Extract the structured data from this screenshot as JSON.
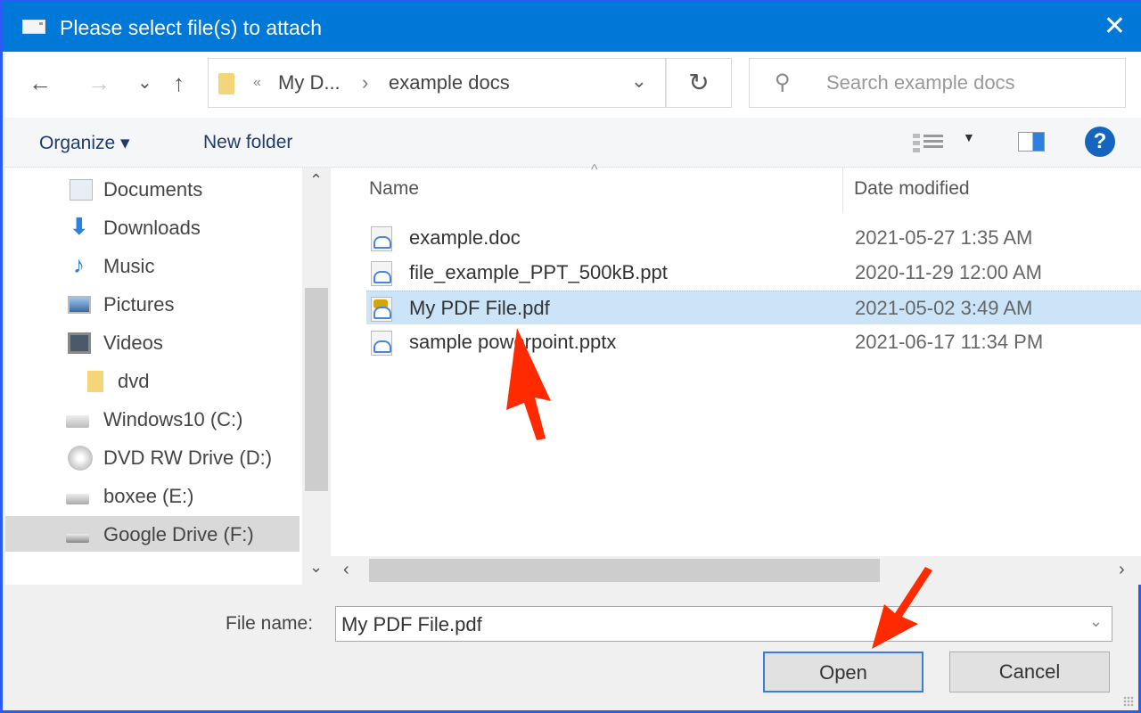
{
  "window": {
    "title": "Please select file(s) to attach",
    "close_icon": "close-icon"
  },
  "nav": {
    "back": "←",
    "forward": "→",
    "recent": "⌄",
    "up": "↑",
    "breadcrumb": [
      "«",
      "My D...",
      "›",
      "example docs"
    ],
    "address_dropdown": "⌄",
    "refresh": "↻",
    "search_placeholder": "Search example docs"
  },
  "toolbar": {
    "organize": "Organize ▾",
    "new_folder": "New folder",
    "views_dropdown": "▼",
    "help": "?"
  },
  "sidebar": {
    "items": [
      {
        "label": "Documents",
        "icon": "documents-icon"
      },
      {
        "label": "Downloads",
        "icon": "downloads-icon"
      },
      {
        "label": "Music",
        "icon": "music-icon"
      },
      {
        "label": "Pictures",
        "icon": "pictures-icon"
      },
      {
        "label": "Videos",
        "icon": "videos-icon"
      },
      {
        "label": "dvd",
        "icon": "folder-icon"
      },
      {
        "label": "Windows10 (C:)",
        "icon": "windows-drive-icon"
      },
      {
        "label": "DVD RW Drive (D:)",
        "icon": "dvd-drive-icon"
      },
      {
        "label": "boxee (E:)",
        "icon": "drive-icon"
      },
      {
        "label": "Google Drive (F:)",
        "icon": "drive-icon",
        "selected": true
      }
    ],
    "scroll_up": "⌃",
    "scroll_down": "⌄"
  },
  "files": {
    "columns": {
      "name": "Name",
      "date": "Date modified",
      "sort_indicator": "^"
    },
    "rows": [
      {
        "name": "example.doc",
        "date": "2021-05-27 1:35 AM"
      },
      {
        "name": "file_example_PPT_500kB.ppt",
        "date": "2020-11-29 12:00 AM"
      },
      {
        "name": "My PDF File.pdf",
        "date": "2021-05-02 3:49 AM",
        "selected": true
      },
      {
        "name": "sample powerpoint.pptx",
        "date": "2021-06-17 11:34 PM"
      }
    ],
    "scroll_left": "‹",
    "scroll_right": "›"
  },
  "footer": {
    "file_name_label": "File name:",
    "file_name_value": "My PDF File.pdf",
    "file_name_dropdown": "⌄",
    "open": "Open",
    "cancel": "Cancel"
  },
  "annotations": {
    "arrow_color": "#ff2a00",
    "arrows": [
      "pointing to selected file My PDF File.pdf",
      "pointing to Open button"
    ]
  }
}
